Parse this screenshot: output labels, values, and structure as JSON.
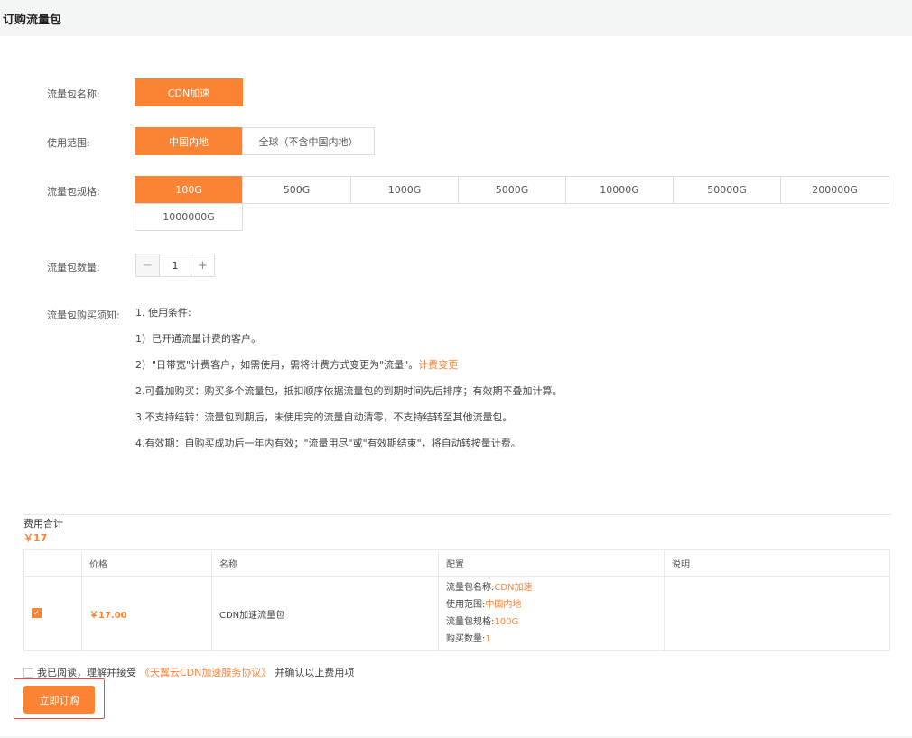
{
  "header": {
    "title": "订购流量包"
  },
  "form": {
    "name_label": "流量包名称:",
    "name_option": "CDN加速",
    "scope_label": "使用范围:",
    "scope_options": [
      "中国内地",
      "全球（不含中国内地）"
    ],
    "spec_label": "流量包规格:",
    "spec_options": [
      "100G",
      "500G",
      "1000G",
      "5000G",
      "10000G",
      "50000G",
      "200000G",
      "1000000G"
    ],
    "qty_label": "流量包数量:",
    "qty_minus": "−",
    "qty_value": "1",
    "qty_plus": "+",
    "notice_label": "流量包购买须知:",
    "notice_lines": [
      "1. 使用条件:",
      "1）已开通流量计费的客户。",
      "2）\"日带宽\"计费客户，如需使用，需将计费方式变更为\"流量\"。",
      "2.可叠加购买：购买多个流量包，抵扣顺序依据流量包的到期时间先后排序；有效期不叠加计算。",
      "3.不支持结转：流量包到期后，未使用完的流量自动清零，不支持结转至其他流量包。",
      "4.有效期：自购买成功后一年内有效；\"流量用尽\"或\"有效期结束\"，将自动转按量计费。"
    ],
    "notice_link": "计费变更"
  },
  "fee": {
    "title": "费用合计",
    "total": "￥17",
    "headers": [
      "价格",
      "名称",
      "配置",
      "说明"
    ],
    "row": {
      "price": "￥17.00",
      "name": "CDN加速流量包",
      "config": [
        {
          "k": "流量包名称:",
          "v": "CDN加速"
        },
        {
          "k": "使用范围:",
          "v": "中国内地"
        },
        {
          "k": "流量包规格:",
          "v": "100G"
        },
        {
          "k": "购买数量:",
          "v": "1"
        }
      ],
      "note": ""
    }
  },
  "agree": {
    "prefix": "我已阅读，理解并接受",
    "link": "《天翼云CDN加速服务协议》",
    "suffix": "并确认以上费用项"
  },
  "submit_label": "立即订购",
  "accent_color": "#fa8334"
}
